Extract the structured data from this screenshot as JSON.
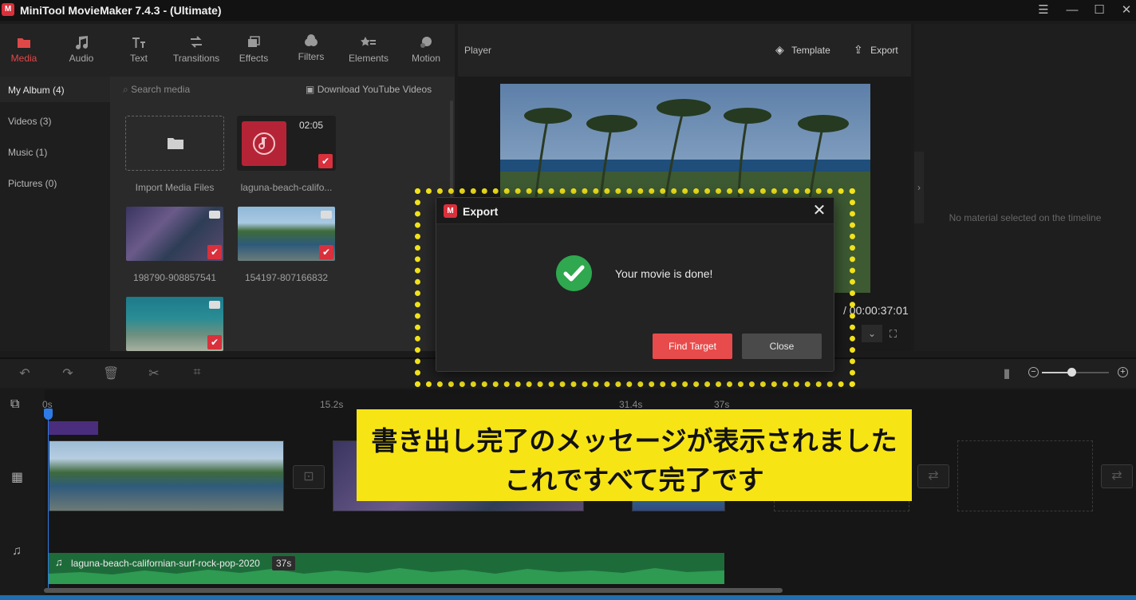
{
  "app": {
    "title": "MiniTool MovieMaker 7.4.3 - (Ultimate)",
    "window_buttons": [
      "menu-icon",
      "minimize-icon",
      "maximize-icon",
      "close-icon"
    ]
  },
  "toolbar": {
    "tabs": [
      {
        "label": "Media",
        "icon": "media-folder-icon",
        "active": true
      },
      {
        "label": "Audio",
        "icon": "music-note-icon"
      },
      {
        "label": "Text",
        "icon": "text-icon"
      },
      {
        "label": "Transitions",
        "icon": "transition-arrows-icon"
      },
      {
        "label": "Effects",
        "icon": "effects-icon"
      },
      {
        "label": "Filters",
        "icon": "filters-icon"
      },
      {
        "label": "Elements",
        "icon": "elements-icon"
      },
      {
        "label": "Motion",
        "icon": "motion-icon"
      }
    ]
  },
  "media": {
    "sidebar": [
      "My Album (4)",
      "Videos (3)",
      "Music (1)",
      "Pictures (0)"
    ],
    "search_placeholder": "Search media",
    "youtube_label": "Download YouTube Videos",
    "items": [
      {
        "label": "Import Media Files"
      },
      {
        "label": "laguna-beach-califo...",
        "duration": "02:05"
      },
      {
        "label": "198790-908857541"
      },
      {
        "label": "154197-807166832"
      },
      {
        "label": ""
      }
    ]
  },
  "player": {
    "title": "Player",
    "template_label": "Template",
    "export_label": "Export",
    "timecode": "/ 00:00:37:01"
  },
  "properties": {
    "empty_msg": "No material selected on the timeline"
  },
  "timeline": {
    "ruler": [
      "0s",
      "15.2s",
      "31.4s",
      "37s"
    ],
    "audio_clip_name": "laguna-beach-californian-surf-rock-pop-2020",
    "audio_clip_duration": "37s"
  },
  "dialog": {
    "title": "Export",
    "message": "Your movie is done!",
    "find_target": "Find Target",
    "close": "Close"
  },
  "caption": {
    "line1": "書き出し完了のメッセージが表示されました",
    "line2": "これですべて完了です"
  },
  "colors": {
    "accent": "#e84b4b",
    "highlight": "#f2e31a",
    "success": "#2fa84f",
    "caption_bg": "#f7e415"
  }
}
